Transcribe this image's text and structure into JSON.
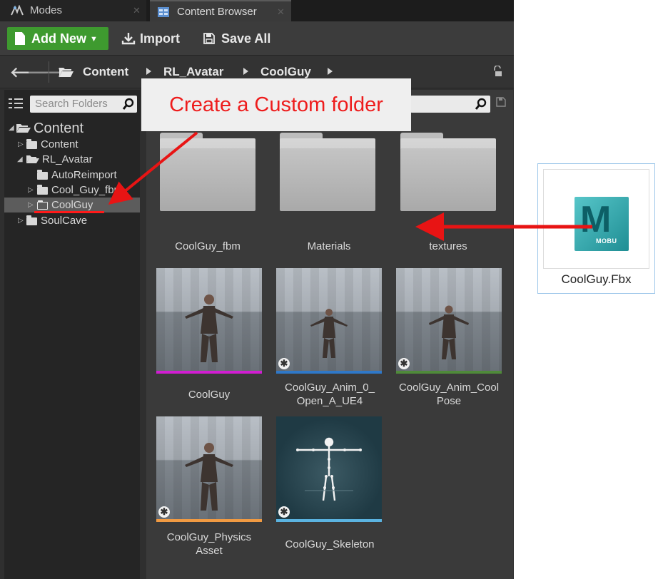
{
  "tabs": [
    {
      "label": "Modes",
      "icon": "modes-icon"
    },
    {
      "label": "Content Browser",
      "icon": "content-browser-icon"
    }
  ],
  "toolbar": {
    "add_new_label": "Add New",
    "import_label": "Import",
    "save_all_label": "Save All"
  },
  "path": {
    "crumbs": [
      "Content",
      "RL_Avatar",
      "CoolGuy"
    ]
  },
  "left_panel": {
    "search_placeholder": "Search Folders",
    "tree": [
      {
        "label": "Content"
      },
      {
        "label": "Content"
      },
      {
        "label": "RL_Avatar"
      },
      {
        "label": "AutoReimport"
      },
      {
        "label": "Cool_Guy_fbm"
      },
      {
        "label": "CoolGuy",
        "selected": true
      },
      {
        "label": "SoulCave"
      }
    ]
  },
  "assets": {
    "folders": [
      "CoolGuy_fbm",
      "Materials",
      "textures"
    ],
    "items": [
      {
        "label": "CoolGuy",
        "bar_color": "#d11ed1",
        "badge": false
      },
      {
        "label": "CoolGuy_Anim_0_\nOpen_A_UE4",
        "bar_color": "#2f78c8",
        "badge": true
      },
      {
        "label": "CoolGuy_Anim_Cool\nPose",
        "bar_color": "#4f8a3a",
        "badge": true
      },
      {
        "label": "CoolGuy_Physics\nAsset",
        "bar_color": "#f09a42",
        "badge": true
      },
      {
        "label": "CoolGuy_Skeleton",
        "bar_color": "#5bb3e0",
        "badge": true
      }
    ]
  },
  "annotation": {
    "callout_text": "Create a Custom folder",
    "arrow_color": "#e81414"
  },
  "fbx_file": {
    "name": "CoolGuy.Fbx",
    "logo_letter": "M",
    "logo_text": "MOBU"
  }
}
